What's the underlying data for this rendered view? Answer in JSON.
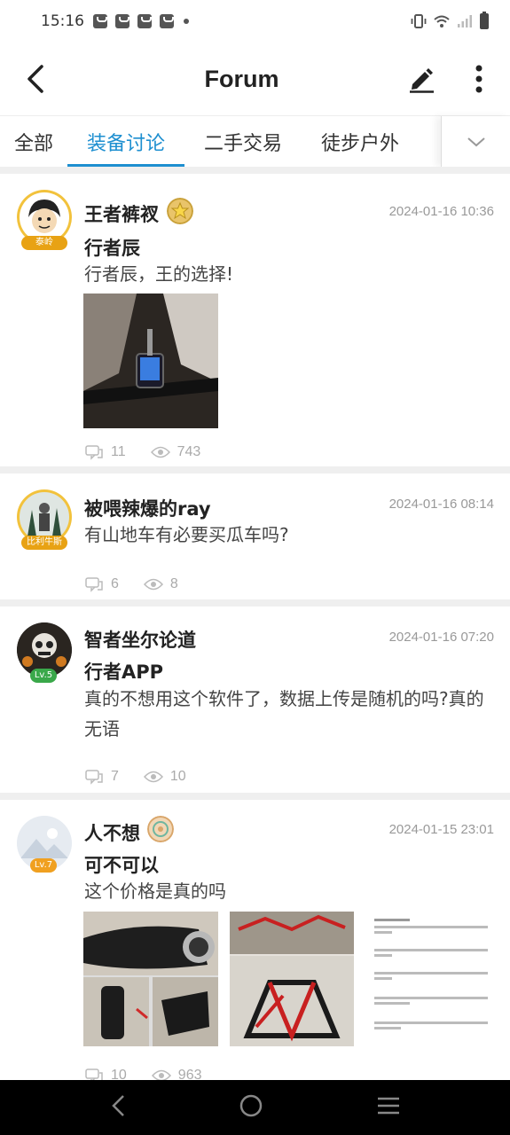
{
  "status": {
    "time": "15:16"
  },
  "app_bar": {
    "title": "Forum"
  },
  "tabs": [
    {
      "label": "全部"
    },
    {
      "label": "装备讨论"
    },
    {
      "label": "二手交易"
    },
    {
      "label": "徒步户外"
    }
  ],
  "active_tab": "装备讨论",
  "posts": [
    {
      "username": "王者裤衩",
      "timestamp": "2024-01-16 10:36",
      "avatar_badge": "泰岭",
      "title": "行者辰",
      "body": "行者辰，王的选择!",
      "comments": "11",
      "views": "743"
    },
    {
      "username": "被喂辣爆的ray",
      "timestamp": "2024-01-16 08:14",
      "avatar_badge": "比利牛斯",
      "body": "有山地车有必要买瓜车吗?",
      "comments": "6",
      "views": "8"
    },
    {
      "username": "智者坐尔论道",
      "timestamp": "2024-01-16 07:20",
      "avatar_badge": "Lv.5",
      "title": "行者APP",
      "body": "真的不想用这个软件了，数据上传是随机的吗?真的无语",
      "comments": "7",
      "views": "10"
    },
    {
      "username": "人不想",
      "timestamp": "2024-01-15 23:01",
      "avatar_badge": "Lv.7",
      "title": "可不可以",
      "body": "这个价格是真的吗",
      "comments": "10",
      "views": "963"
    }
  ],
  "colors": {
    "accent": "#1e8fd0",
    "badge_gold": "#e8a214",
    "badge_green": "#3aa84a",
    "badge_orange": "#f0a020"
  },
  "icons": [
    "back-arrow-icon",
    "edit-pencil-icon",
    "more-vertical-icon",
    "chevron-down-icon",
    "comment-icon",
    "eye-icon"
  ]
}
